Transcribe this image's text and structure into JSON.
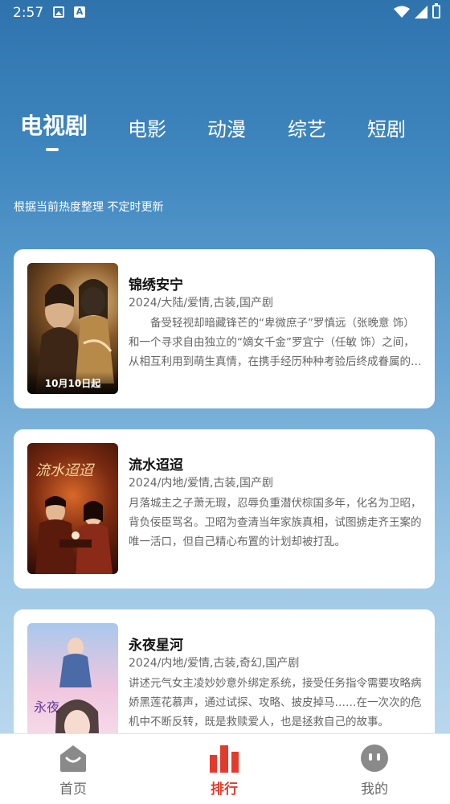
{
  "status_bar": {
    "time": "2:57"
  },
  "tabs": [
    {
      "label": "电视剧",
      "active": true
    },
    {
      "label": "电影",
      "active": false
    },
    {
      "label": "动漫",
      "active": false
    },
    {
      "label": "综艺",
      "active": false
    },
    {
      "label": "短剧",
      "active": false
    }
  ],
  "subtitle": "根据当前热度整理 不定时更新",
  "cards": [
    {
      "title": "锦绣安宁",
      "meta": "2024/大陆/爱情,古装,国产剧",
      "description": "备受轻视却暗藏锋芒的“卑微庶子”罗慎远（张晚意 饰）和一个寻求自由独立的“嫡女千金”罗宜宁（任敏 饰）之间，从相互利用到萌生真情，在携手经历种种考验后终成眷属的故事。",
      "poster_badge": "10月10日起"
    },
    {
      "title": "流水迢迢",
      "meta": "2024/内地/爱情,古装,国产剧",
      "description": "月落城主之子萧无瑕，忍辱负重潜伏棕国多年，化名为卫昭，背负佞臣骂名。卫昭为查清当年家族真相，试图掳走齐王案的唯一活口，但自己精心布置的计划却被打乱。",
      "poster_badge": ""
    },
    {
      "title": "永夜星河",
      "meta": "2024/内地/爱情,古装,奇幻,国产剧",
      "description": "讲述元气女主凌妙妙意外绑定系统，接受任务指令需要攻略病娇黑莲花慕声，通过试探、攻略、披皮掉马……在一次次的危机中不断反转，既是救赎爱人，也是拯救自己的故事。",
      "poster_badge": ""
    }
  ],
  "bottom_nav": [
    {
      "label": "首页",
      "icon": "home-icon",
      "active": false
    },
    {
      "label": "排行",
      "icon": "ranking-icon",
      "active": true
    },
    {
      "label": "我的",
      "icon": "profile-icon",
      "active": false
    }
  ],
  "colors": {
    "accent": "#e23b2c",
    "header_blue": "#2f73ad"
  }
}
